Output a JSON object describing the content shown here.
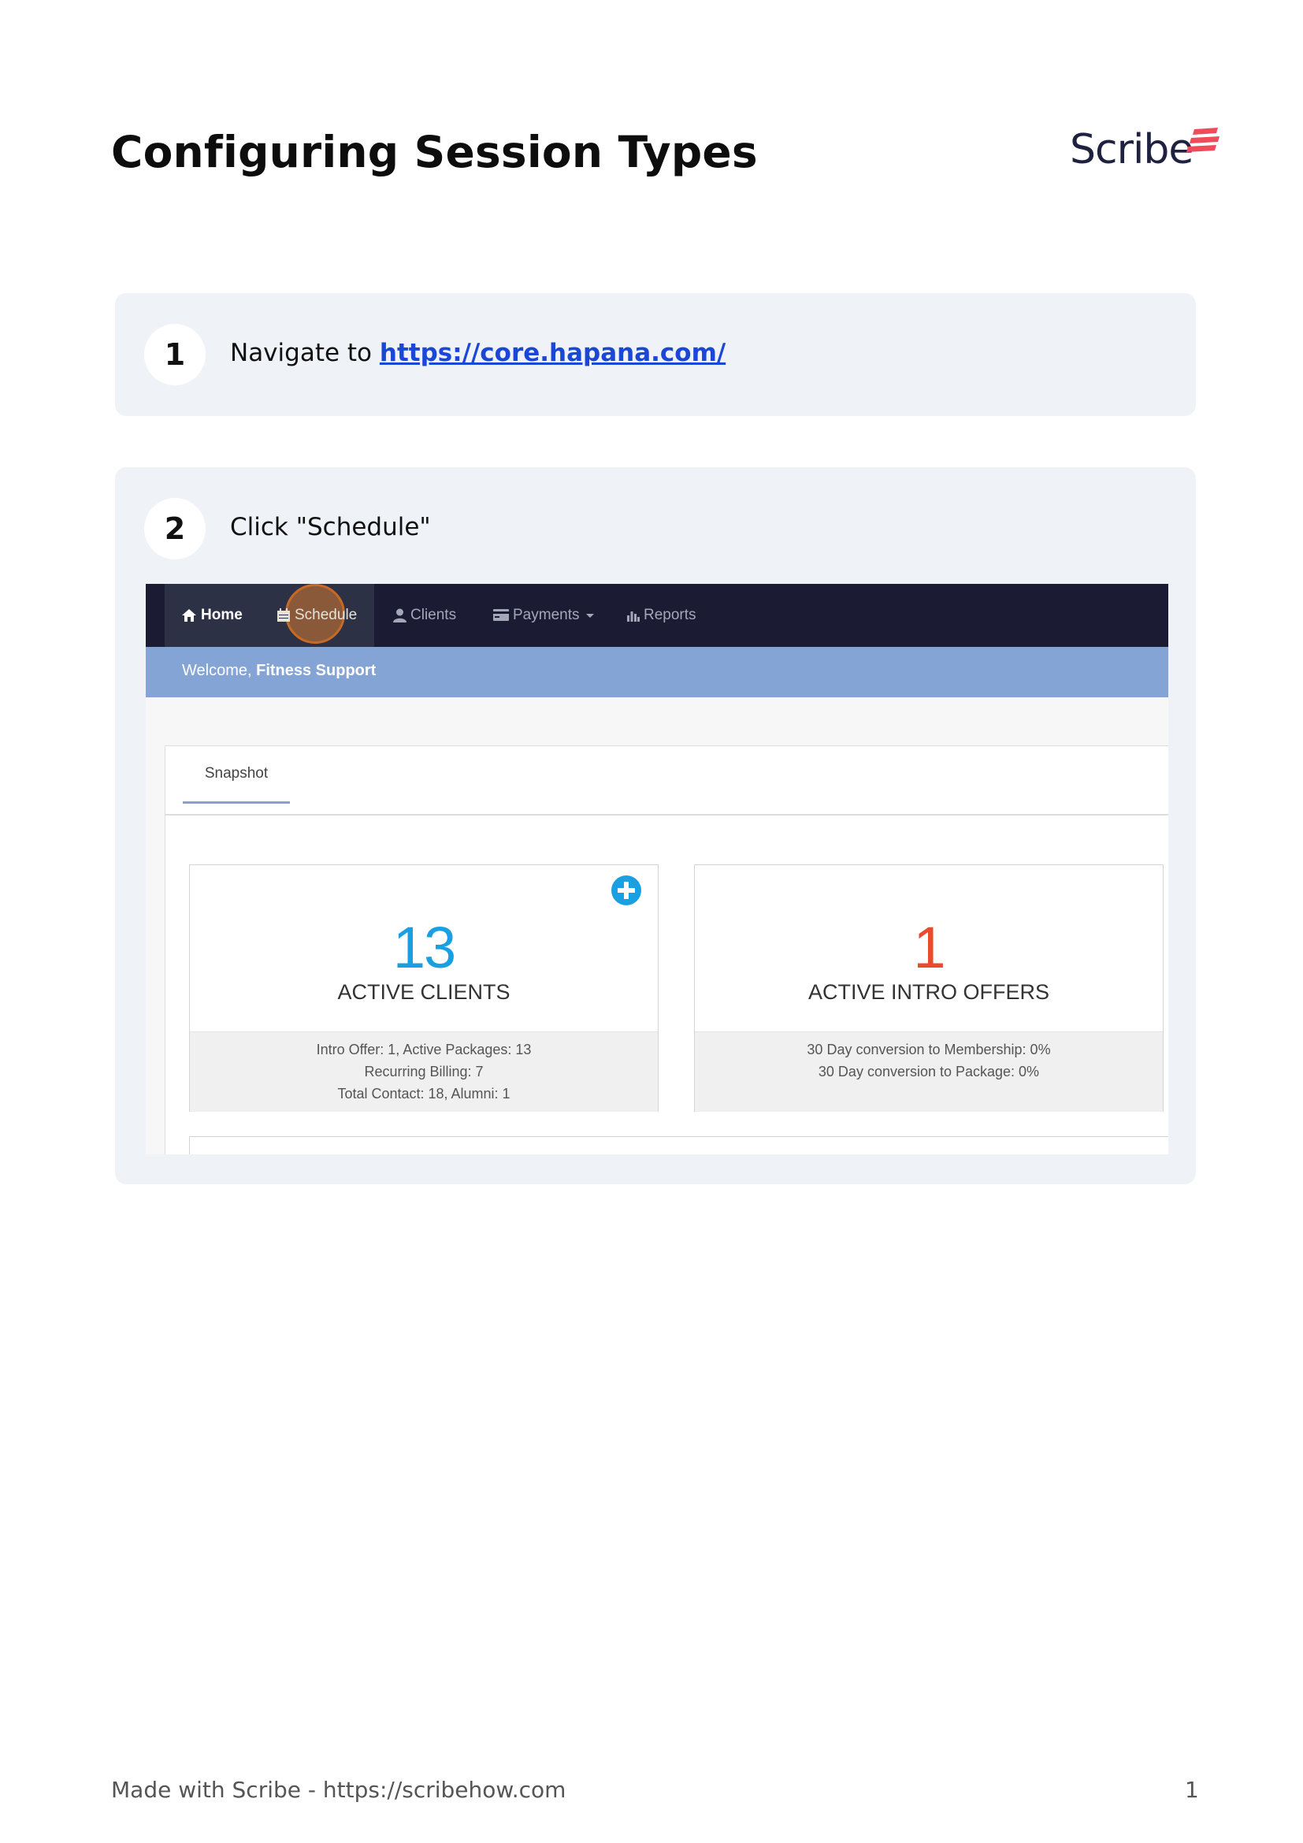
{
  "document": {
    "title": "Configuring Session Types",
    "logo_text": "Scribe",
    "footer": "Made with Scribe - https://scribehow.com",
    "page_number": "1"
  },
  "steps": [
    {
      "number": "1",
      "text": "Navigate to ",
      "link": "https://core.hapana.com/"
    },
    {
      "number": "2",
      "text": "Click \"Schedule\""
    }
  ],
  "screenshot": {
    "nav": [
      {
        "label": "Home",
        "icon": "home-icon"
      },
      {
        "label": "Schedule",
        "icon": "calendar-icon"
      },
      {
        "label": "Clients",
        "icon": "user-icon"
      },
      {
        "label": "Payments",
        "icon": "credit-card-icon"
      },
      {
        "label": "Reports",
        "icon": "bar-chart-icon"
      }
    ],
    "welcome_prefix": "Welcome, ",
    "welcome_name": "Fitness Support",
    "tab": "Snapshot",
    "cards": [
      {
        "value": "13",
        "label": "ACTIVE CLIENTS",
        "value_color": "#1aa0e0",
        "footer": [
          "Intro Offer: 1, Active Packages: 13",
          "Recurring Billing: 7",
          "Total Contact: 18, Alumni: 1"
        ]
      },
      {
        "value": "1",
        "label": "ACTIVE INTRO OFFERS",
        "value_color": "#ec4a2c",
        "footer": [
          "30 Day conversion to Membership: 0%",
          "30 Day conversion to Package: 0%"
        ]
      }
    ]
  },
  "colors": {
    "nav_bg": "#1b1b33",
    "welcome_bar": "#85a4d6",
    "link": "#1a47d6",
    "logo_accent": "#ef4b5b",
    "step_card_bg": "#eff2f7"
  }
}
